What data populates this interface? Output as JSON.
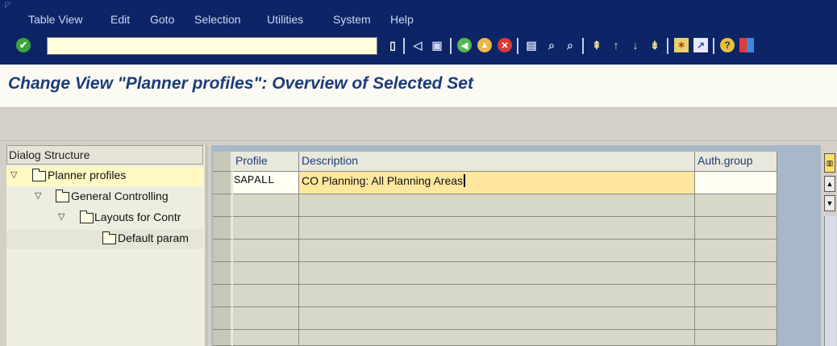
{
  "menu": [
    "Table View",
    "Edit",
    "Goto",
    "Selection",
    "Utilities",
    "System",
    "Help"
  ],
  "toolbar": {
    "command_field_value": ""
  },
  "title": "Change View \"Planner profiles\": Overview of Selected Set",
  "dialog_structure": {
    "header": "Dialog Structure",
    "items": [
      {
        "label": "Planner profiles",
        "expanded": true,
        "level": 0,
        "selected": true
      },
      {
        "label": "General Controlling",
        "expanded": true,
        "level": 1
      },
      {
        "label": "Layouts for Contr",
        "expanded": true,
        "level": 2
      },
      {
        "label": "Default param",
        "level": 3
      }
    ]
  },
  "table": {
    "columns": [
      "Profile",
      "Description",
      "Auth.group"
    ],
    "rows": [
      {
        "profile": "SAPALL",
        "description": "CO Planning: All Planning Areas",
        "auth_group": ""
      }
    ]
  },
  "colors": {
    "menubar": "#0d2466",
    "title": "#1c3c78",
    "background": "#d4d0c8",
    "selected_cell": "#ffe89e"
  }
}
